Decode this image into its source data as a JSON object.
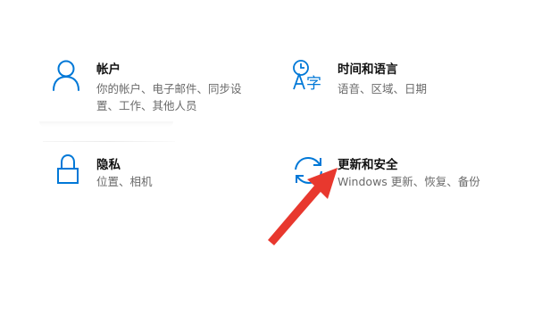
{
  "settings_tiles": {
    "account": {
      "title": "帐户",
      "desc_line1": "你的帐户、电子邮件、同步设",
      "desc_line2": "置、工作、其他人员",
      "icon": "person-icon"
    },
    "time_language": {
      "title": "时间和语言",
      "desc": "语音、区域、日期",
      "icon": "time-language-icon"
    },
    "privacy": {
      "title": "隐私",
      "desc": "位置、相机",
      "icon": "lock-icon"
    },
    "update_security": {
      "title": "更新和安全",
      "desc": "Windows 更新、恢复、备份",
      "icon": "sync-icon"
    }
  },
  "colors": {
    "accent": "#0078d7",
    "title_text": "#111111",
    "desc_text": "#6a6a6a",
    "annotation_arrow": "#e8382e"
  },
  "annotation": {
    "icon": "red-arrow-icon"
  }
}
